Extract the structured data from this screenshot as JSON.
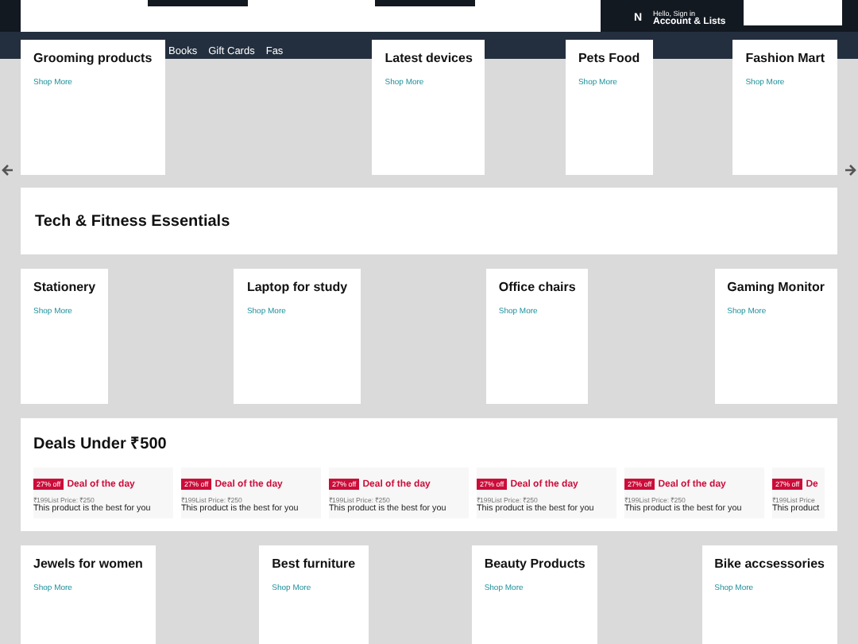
{
  "header": {
    "cut_letter": "N",
    "greeting": "Hello, Sign in",
    "account": "Account & Lists"
  },
  "nav": {
    "items": [
      "Books",
      "Gift Cards",
      "Fas"
    ]
  },
  "category_rows": [
    [
      {
        "title": "Grooming products",
        "link": "Shop More"
      },
      {
        "title": "Latest devices",
        "link": "Shop More"
      },
      {
        "title": "Pets Food",
        "link": "Shop More"
      },
      {
        "title": "Fashion Mart",
        "link": "Shop More"
      }
    ]
  ],
  "banner": {
    "title": "Tech & Fitness Essentials"
  },
  "category_row_2": [
    {
      "title": "Stationery",
      "link": "Shop More"
    },
    {
      "title": "Laptop for study",
      "link": "Shop More"
    },
    {
      "title": "Office chairs",
      "link": "Shop More"
    },
    {
      "title": "Gaming Monitor",
      "link": "Shop More"
    }
  ],
  "deals": {
    "title": "Deals Under ₹500",
    "items": [
      {
        "badge": "27% off",
        "label": "Deal of the day",
        "price": "₹199List Price: ₹250",
        "description": "This product is the best for you"
      },
      {
        "badge": "27% off",
        "label": "Deal of the day",
        "price": "₹199List Price: ₹250",
        "description": "This product is the best for you"
      },
      {
        "badge": "27% off",
        "label": "Deal of the day",
        "price": "₹199List Price: ₹250",
        "description": "This product is the best for you"
      },
      {
        "badge": "27% off",
        "label": "Deal of the day",
        "price": "₹199List Price: ₹250",
        "description": "This product is the best for you"
      },
      {
        "badge": "27% off",
        "label": "Deal of the day",
        "price": "₹199List Price: ₹250",
        "description": "This product is the best for you"
      },
      {
        "badge": "27% off",
        "label": "De",
        "price": "₹199List Price",
        "description": "This product"
      }
    ]
  },
  "category_row_3": [
    {
      "title": "Jewels for women",
      "link": "Shop More"
    },
    {
      "title": "Best furniture",
      "link": "Shop More"
    },
    {
      "title": "Beauty Products",
      "link": "Shop More"
    },
    {
      "title": "Bike accsessories",
      "link": "Shop More"
    }
  ]
}
